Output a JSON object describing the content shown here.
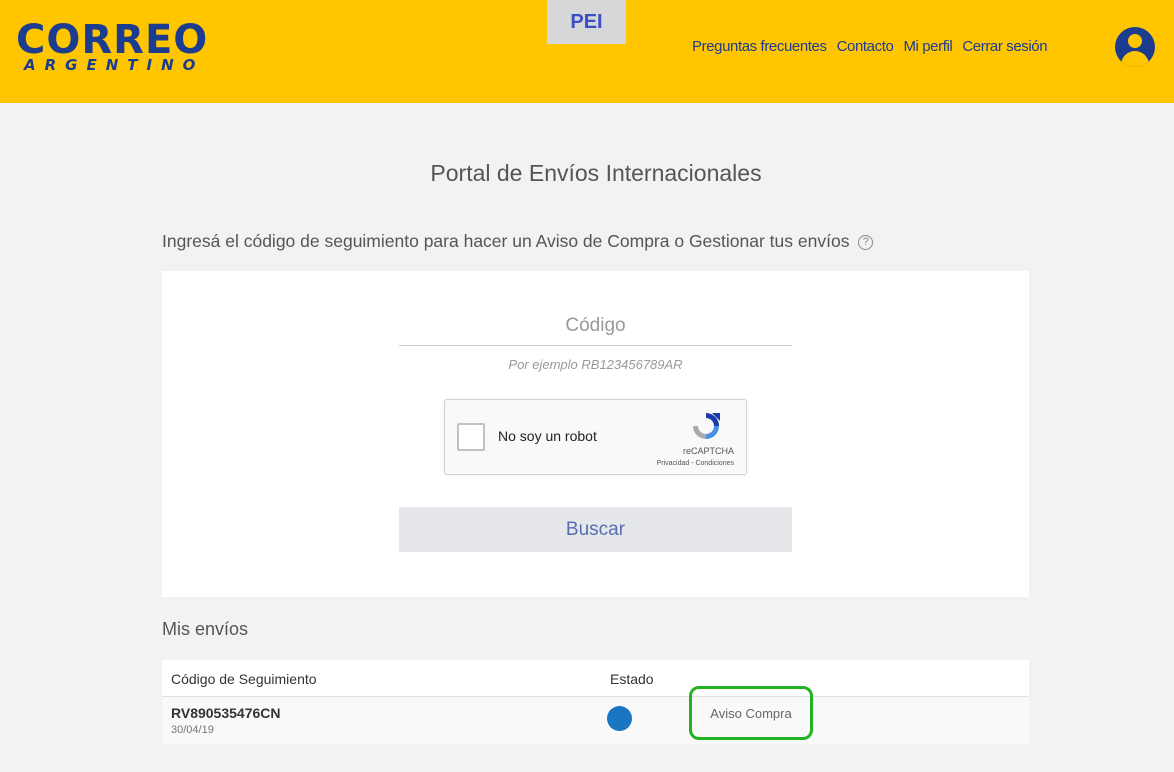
{
  "header": {
    "logo_main": "CORREO",
    "logo_sub": "ARGENTINO",
    "badge": "PEI",
    "nav": [
      "Preguntas frecuentes",
      "Contacto",
      "Mi perfil",
      "Cerrar sesión"
    ],
    "avatar_icon": "user-circle-icon",
    "colors": {
      "bar": "#ffc600",
      "brand": "#1b3c8f"
    }
  },
  "main": {
    "title": "Portal de Envíos Internacionales",
    "subtitle": "Ingresá el código de seguimiento para hacer un Aviso de Compra o Gestionar tus envíos",
    "help_icon": "?",
    "code_placeholder": "Código",
    "code_value": "",
    "example": "Por ejemplo RB123456789AR",
    "captcha": {
      "label": "No soy un robot",
      "brand": "reCAPTCHA",
      "links": "Privacidad - Condiciones",
      "checked": false
    },
    "search_label": "Buscar"
  },
  "shipments": {
    "title": "Mis envíos",
    "columns": [
      "Código de Seguimiento",
      "Estado"
    ],
    "rows": [
      {
        "code": "RV890535476CN",
        "date": "30/04/19",
        "status_color": "#1a75c2",
        "action": "Aviso Compra"
      }
    ]
  }
}
